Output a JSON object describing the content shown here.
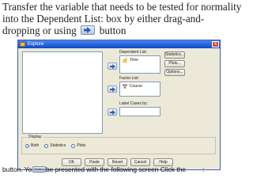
{
  "instruction": {
    "line1": "Transfer the variable that needs to be tested for normality",
    "line2": "into the Dependent List: box by either drag-and-",
    "line3_pre": "dropping or using",
    "line3_post": "button"
  },
  "dialog": {
    "title": "Explore",
    "dependent_list_label": "Dependent List:",
    "dependent_item": "Time",
    "factor_list_label": "Factor List:",
    "factor_item": "Course",
    "label_cases_label": "Label Cases by:",
    "side_buttons": [
      "Statistics...",
      "Plots...",
      "Options..."
    ],
    "display": {
      "legend": "Display",
      "options": [
        "Both",
        "Statistics",
        "Plots"
      ],
      "selected": "Both"
    },
    "bottom_buttons": [
      "OK",
      "Paste",
      "Reset",
      "Cancel",
      "Help"
    ]
  },
  "footer": {
    "text_left": "button. Yo",
    "chip_label": "Statistics",
    "text_mid": "be presented with the following screen Click the",
    "text_right": ":"
  },
  "colors": {
    "titlebar": "#0c49c9",
    "dialog_bg": "#ece9d8"
  }
}
